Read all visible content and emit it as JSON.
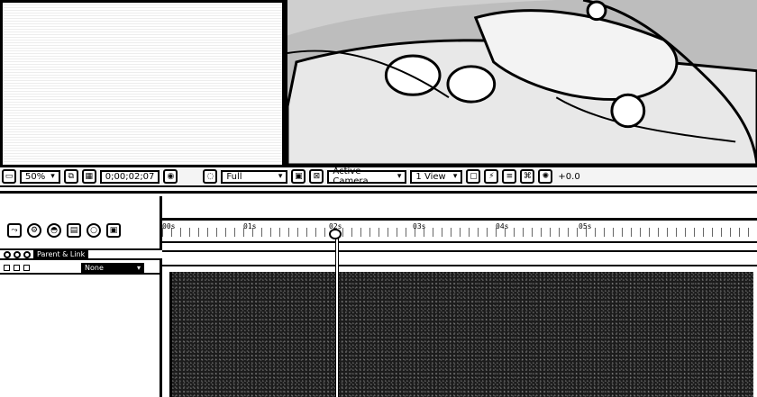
{
  "viewer_toolbar": {
    "zoom": "50%",
    "timecode": "0;00;02;07",
    "resolution": "Full",
    "camera": "Active Camera",
    "view_layout": "1 View",
    "exposure": "+0.0"
  },
  "timeline": {
    "columns": {
      "parent_link": "Parent & Link"
    },
    "layer": {
      "parent_value": "None"
    },
    "ruler_labels": [
      "00s",
      "01s",
      "02s",
      "03s",
      "04s",
      "05s"
    ]
  },
  "icons": {
    "snapshot": "camera-icon",
    "grid": "grid-icon",
    "region": "region-of-interest-icon",
    "transparency": "transparency-grid-icon",
    "solo": "solo-icon",
    "graph": "graph-editor-icon"
  }
}
